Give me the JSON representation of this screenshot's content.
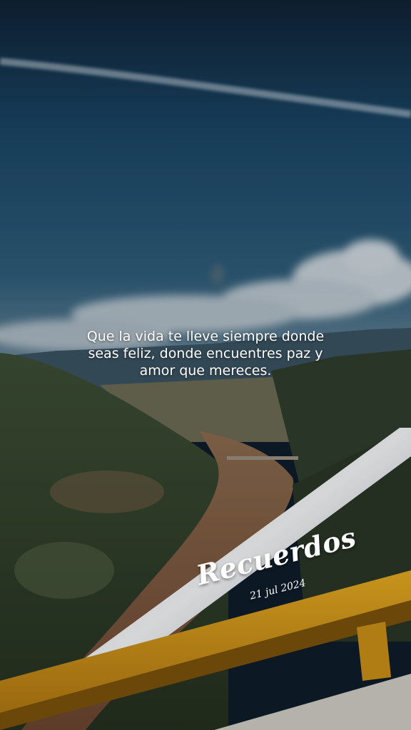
{
  "quote": "Que la vida te lleve siempre donde seas feliz, donde encuentres paz y amor que mereces.",
  "stamp": {
    "title": "Recuerdos",
    "date": "21 jul 2024"
  },
  "colors": {
    "sky": "#1d4a6c",
    "river": "#7a5438",
    "railing": "#d69a1a"
  }
}
